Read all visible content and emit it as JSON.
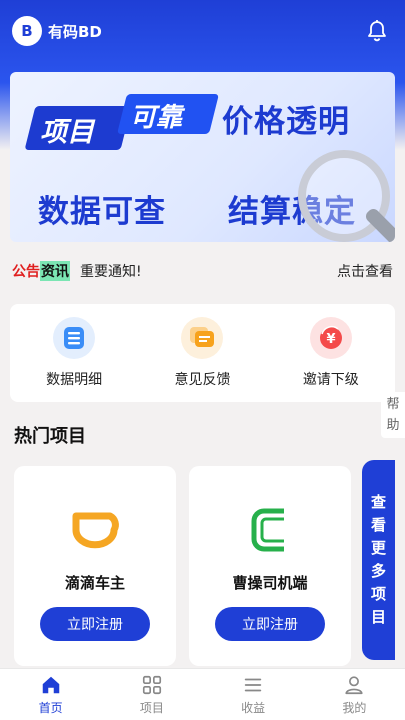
{
  "header": {
    "app_title": "有码BD",
    "logo_text": "B"
  },
  "banner": {
    "pill_1": "项目",
    "pill_2": "可靠",
    "line_1_right": "价格透明",
    "line_2_left": "数据可查",
    "line_2_right": "结算稳定"
  },
  "notice": {
    "tag_1": "公告",
    "tag_2": "资讯",
    "message": "重要通知!",
    "more": "点击查看"
  },
  "quick_actions": [
    {
      "label": "数据明细",
      "icon": "data-detail-icon",
      "color": "#3a8df7"
    },
    {
      "label": "意见反馈",
      "icon": "feedback-icon",
      "color": "#f7a21c"
    },
    {
      "label": "邀请下级",
      "icon": "invite-icon",
      "color": "#f44a4a"
    }
  ],
  "help": {
    "line1": "帮",
    "line2": "助"
  },
  "hot": {
    "title": "热门项目",
    "projects": [
      {
        "name": "滴滴车主",
        "button": "立即注册",
        "icon": "didi-logo-icon",
        "color": "#f5a623"
      },
      {
        "name": "曹操司机端",
        "button": "立即注册",
        "icon": "caocao-logo-icon",
        "color": "#27b04b"
      }
    ],
    "more_chars": [
      "查",
      "看",
      "更",
      "多",
      "项",
      "目"
    ]
  },
  "tabbar": [
    {
      "label": "首页",
      "icon": "home-icon",
      "active": true
    },
    {
      "label": "项目",
      "icon": "grid-icon",
      "active": false
    },
    {
      "label": "收益",
      "icon": "menu-icon",
      "active": false
    },
    {
      "label": "我的",
      "icon": "user-icon",
      "active": false
    }
  ],
  "colors": {
    "primary": "#1f3fd6",
    "accent_red": "#e01f1f",
    "accent_green": "#7be5b3"
  }
}
